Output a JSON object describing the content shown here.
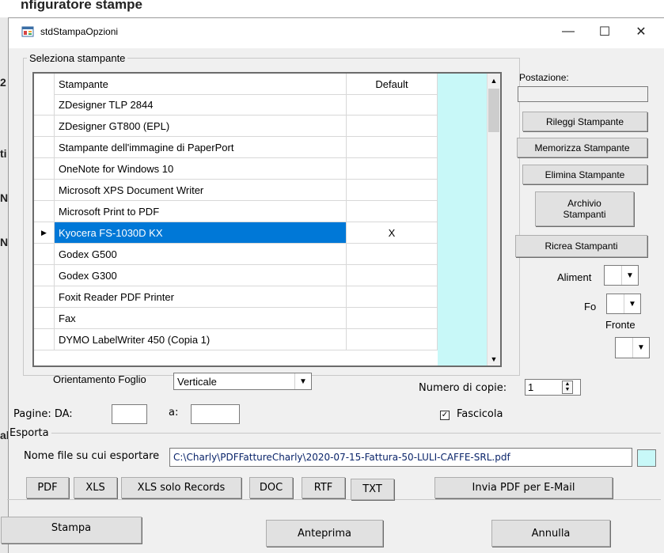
{
  "background": {
    "title_fragment": "nfiguratore stampe",
    "left_chars": [
      "2",
      "ti",
      "N",
      "N",
      "al"
    ]
  },
  "window": {
    "title": "stdStampaOpzioni",
    "controls": {
      "minimize": "—",
      "maximize": "☐",
      "close": "✕"
    }
  },
  "printer_group": {
    "legend": "Seleziona stampante",
    "columns": {
      "name": "Stampante",
      "default": "Default"
    },
    "rows": [
      {
        "name": "ZDesigner TLP 2844",
        "default": ""
      },
      {
        "name": "ZDesigner GT800 (EPL)",
        "default": ""
      },
      {
        "name": "Stampante dell'immagine di PaperPort",
        "default": ""
      },
      {
        "name": "OneNote for Windows 10",
        "default": ""
      },
      {
        "name": "Microsoft XPS Document Writer",
        "default": ""
      },
      {
        "name": "Microsoft Print to PDF",
        "default": ""
      },
      {
        "name": "Kyocera FS-1030D KX",
        "default": "X",
        "selected": true
      },
      {
        "name": "Godex G500",
        "default": ""
      },
      {
        "name": "Godex G300",
        "default": ""
      },
      {
        "name": "Foxit Reader PDF Printer",
        "default": ""
      },
      {
        "name": "Fax",
        "default": ""
      },
      {
        "name": "DYMO LabelWriter 450 (Copia 1)",
        "default": ""
      }
    ],
    "current_row_marker": "▶",
    "postazione_label": "Postazione:",
    "postazione_value": "",
    "buttons": {
      "rileggi": "Rileggi Stampante",
      "memorizza": "Memorizza Stampante",
      "elimina": "Elimina Stampante",
      "archivio": "Archivio Stampanti",
      "ricrea": "Ricrea Stampanti"
    },
    "aliment_label": "Aliment",
    "fo_label": "Fo",
    "fronte_label": "Fronte"
  },
  "options": {
    "orientamento_label": "Orientamento Foglio",
    "orientamento_value": "Verticale",
    "copie_label": "Numero di copie:",
    "copie_value": "1",
    "pagine_label": "Pagine: DA:",
    "a_label": "a:",
    "da_value": "",
    "a_value": "",
    "fascicola_label": "Fascicola",
    "fascicola_checked": true
  },
  "export": {
    "legend": "Esporta",
    "file_label": "Nome file su cui esportare",
    "file_value": "C:\\Charly\\PDFFattureCharly\\2020-07-15-Fattura-50-LULI-CAFFE-SRL.pdf",
    "buttons": {
      "pdf": "PDF",
      "xls": "XLS",
      "xls_records": "XLS solo Records",
      "doc": "DOC",
      "rtf": "RTF",
      "txt": "TXT",
      "email": "Invia PDF per E-Mail"
    }
  },
  "footer": {
    "stampa": "Stampa",
    "anteprima": "Anteprima",
    "annulla": "Annulla"
  },
  "colors": {
    "selection": "#0078d7",
    "grid_filler": "#c8f8f8",
    "export_swatch": "#c8f8f8"
  }
}
